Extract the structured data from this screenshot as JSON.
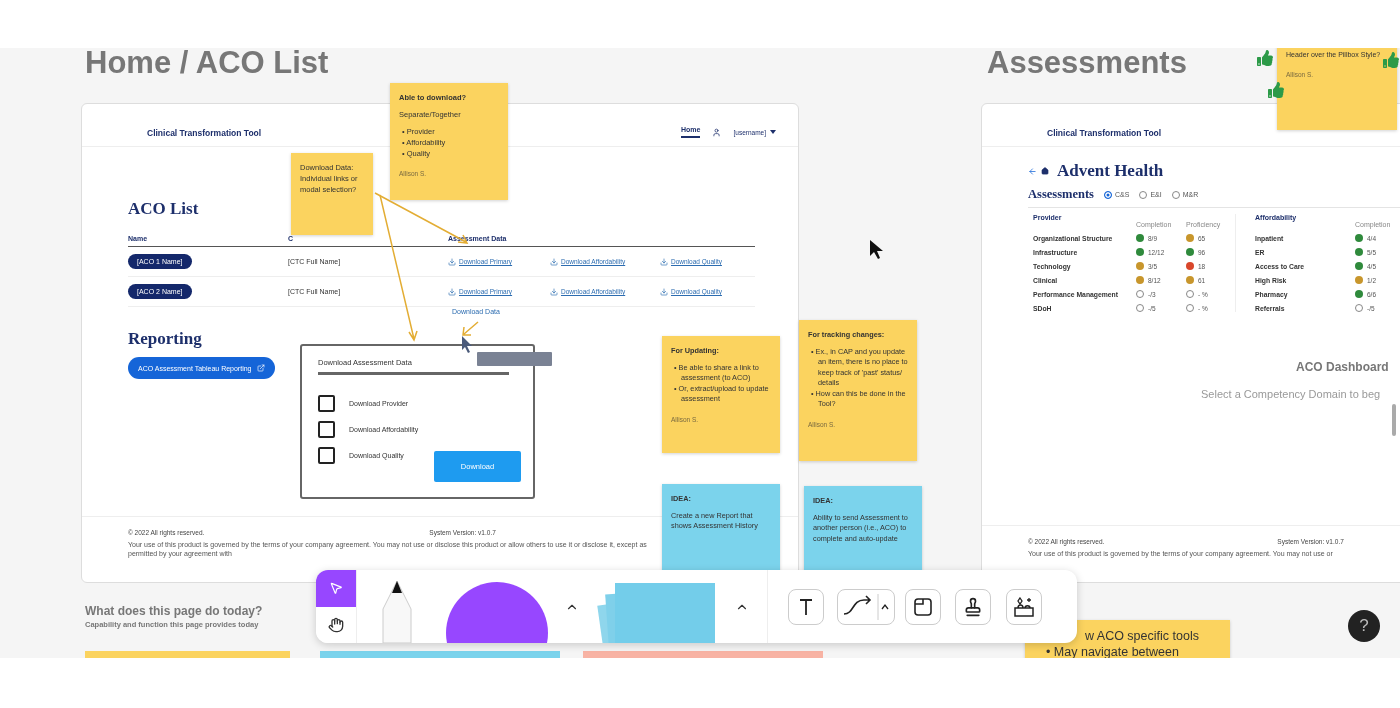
{
  "aco_list_frame": {
    "title": "Home / ACO List",
    "app_name": "Clinical Transformation Tool",
    "nav": [
      {
        "label": "Home",
        "selected": true
      }
    ],
    "user": "[username]",
    "heading": "ACO List",
    "columns": [
      "Name",
      "C",
      "Assessment Data"
    ],
    "rows": [
      {
        "name": "[ACO 1 Name]",
        "ctc": "[CTC Full Name]",
        "downloads": [
          "Download Primary",
          "Download Affordability",
          "Download Quality"
        ]
      },
      {
        "name": "[ACO 2 Name]",
        "ctc": "[CTC Full Name]",
        "downloads": [
          "Download Primary",
          "Download Affordability",
          "Download Quality"
        ]
      }
    ],
    "download_data_link": "Download Data",
    "reporting_heading": "Reporting",
    "reporting_button": "ACO Assessment Tableau Reporting",
    "copyright": "© 2022 All rights reserved.",
    "version": "System Version: v1.0.7",
    "legal": "Your use of this product is governed by the terms of your company agreement. You may not use or disclose this product or allow others to use it or disclose it, except as permitted by your agreement with"
  },
  "download_modal": {
    "title": "Download Assessment Data",
    "options": [
      {
        "label": "Download Provider",
        "checked": false
      },
      {
        "label": "Download Affordability",
        "checked": false
      },
      {
        "label": "Download Quality",
        "checked": false
      }
    ],
    "button": "Download"
  },
  "assessments_frame": {
    "title": "Assessments",
    "app_name": "Clinical Transformation Tool",
    "heading": "Advent Health",
    "section_title": "Assessments",
    "radios": [
      {
        "label": "C&S",
        "selected": true
      },
      {
        "label": "E&I",
        "selected": false
      },
      {
        "label": "M&R",
        "selected": false
      }
    ],
    "groups": [
      {
        "title": "Provider",
        "columns": [
          "Completion",
          "Proficiency"
        ],
        "rows": [
          {
            "label": "Organizational Structure",
            "cells": [
              {
                "kind": "dot",
                "color": "#2f8a3c",
                "text": "8/9"
              },
              {
                "kind": "dot",
                "color": "#c8962c",
                "text": "65"
              }
            ]
          },
          {
            "label": "Infrastructure",
            "cells": [
              {
                "kind": "dot",
                "color": "#2f8a3c",
                "text": "12/12"
              },
              {
                "kind": "dot",
                "color": "#2f8a3c",
                "text": "96"
              }
            ]
          },
          {
            "label": "Technology",
            "cells": [
              {
                "kind": "dot",
                "color": "#c8962c",
                "text": "3/5"
              },
              {
                "kind": "dot",
                "color": "#d9472b",
                "text": "18"
              }
            ]
          },
          {
            "label": "Clinical",
            "cells": [
              {
                "kind": "dot",
                "color": "#c8962c",
                "text": "8/12"
              },
              {
                "kind": "dot",
                "color": "#c8962c",
                "text": "61"
              }
            ]
          },
          {
            "label": "Performance Management",
            "cells": [
              {
                "kind": "empty",
                "text": "-/3"
              },
              {
                "kind": "empty",
                "text": "- %"
              }
            ]
          },
          {
            "label": "SDoH",
            "cells": [
              {
                "kind": "empty",
                "text": "-/5"
              },
              {
                "kind": "empty",
                "text": "- %"
              }
            ]
          }
        ]
      },
      {
        "title": "Affordability",
        "columns": [
          "Completion"
        ],
        "rows": [
          {
            "label": "Inpatient",
            "cells": [
              {
                "kind": "dot",
                "color": "#2f8a3c",
                "text": "4/4"
              }
            ]
          },
          {
            "label": "ER",
            "cells": [
              {
                "kind": "dot",
                "color": "#2f8a3c",
                "text": "5/5"
              }
            ]
          },
          {
            "label": "Access to Care",
            "cells": [
              {
                "kind": "dot",
                "color": "#2f8a3c",
                "text": "4/5"
              }
            ]
          },
          {
            "label": "High Risk",
            "cells": [
              {
                "kind": "dot",
                "color": "#c8962c",
                "text": "1/2"
              }
            ]
          },
          {
            "label": "Pharmacy",
            "cells": [
              {
                "kind": "dot",
                "color": "#2f8a3c",
                "text": "6/6"
              }
            ]
          },
          {
            "label": "Referrals",
            "cells": [
              {
                "kind": "empty",
                "text": "-/5"
              }
            ]
          }
        ]
      }
    ],
    "dashboard_title": "ACO Dashboard",
    "dashboard_hint": "Select a Competency Domain to beg",
    "copyright": "© 2022 All rights reserved.",
    "version": "System Version: v1.0.7",
    "legal": "Your use of this product is governed by the terms of your company agreement. You may not use or"
  },
  "sticky_notes": [
    {
      "color": "#fbd35f",
      "title": "Able to download?",
      "lines": [
        "Separate/Together"
      ],
      "bullets": [
        "• Provider",
        "• Affordability",
        "• Quality"
      ],
      "author": "Allison S."
    },
    {
      "color": "#fbd35f",
      "lines": [
        "Download Data: Individual links or modal selection?"
      ]
    },
    {
      "color": "#fbd35f",
      "title": "For Updating:",
      "bullets": [
        "• Be able to share a link to assessment (to ACO)",
        "• Or, extract/upload to update assessment"
      ],
      "author": "Allison S."
    },
    {
      "color": "#fbd35f",
      "title": "For tracking changes:",
      "bullets": [
        "• Ex., in CAP and you update an item, there is no place to keep track of 'past' status/ details",
        "• How can this be done in the Tool?"
      ],
      "author": "Allison S."
    },
    {
      "color": "#7bd3ec",
      "title": "IDEA:",
      "lines": [
        "Create a new Report that shows Assessment History"
      ]
    },
    {
      "color": "#7bd3ec",
      "title": "IDEA:",
      "lines": [
        "Ability to send Assessment to another person (i.e., ACO) to complete and auto-update"
      ]
    },
    {
      "color": "#fbd35f",
      "lines": [
        "Header over the Pillbox Style?"
      ],
      "author": "Allison S."
    },
    {
      "color": "#fbd35f",
      "lines": [
        "w ACO specific tools"
      ],
      "bullets": [
        "• May navigate between"
      ]
    }
  ],
  "page_notes": {
    "title": "What does this page do today?",
    "subtitle": "Capability and function this page provides today"
  },
  "toolbar": {
    "tools": [
      {
        "kind": "select",
        "selected": true
      },
      {
        "kind": "hand",
        "selected": false
      },
      {
        "kind": "pen",
        "selected": false
      },
      {
        "kind": "shape",
        "selected": false
      },
      {
        "kind": "caret",
        "selected": false
      },
      {
        "kind": "sticky",
        "selected": false
      },
      {
        "kind": "caret",
        "selected": false
      },
      {
        "kind": "text",
        "selected": false
      },
      {
        "kind": "connector",
        "selected": false
      },
      {
        "kind": "section",
        "selected": false
      },
      {
        "kind": "stamp",
        "selected": false
      },
      {
        "kind": "widgets",
        "selected": false
      }
    ]
  },
  "help_button": {
    "label": "?"
  }
}
